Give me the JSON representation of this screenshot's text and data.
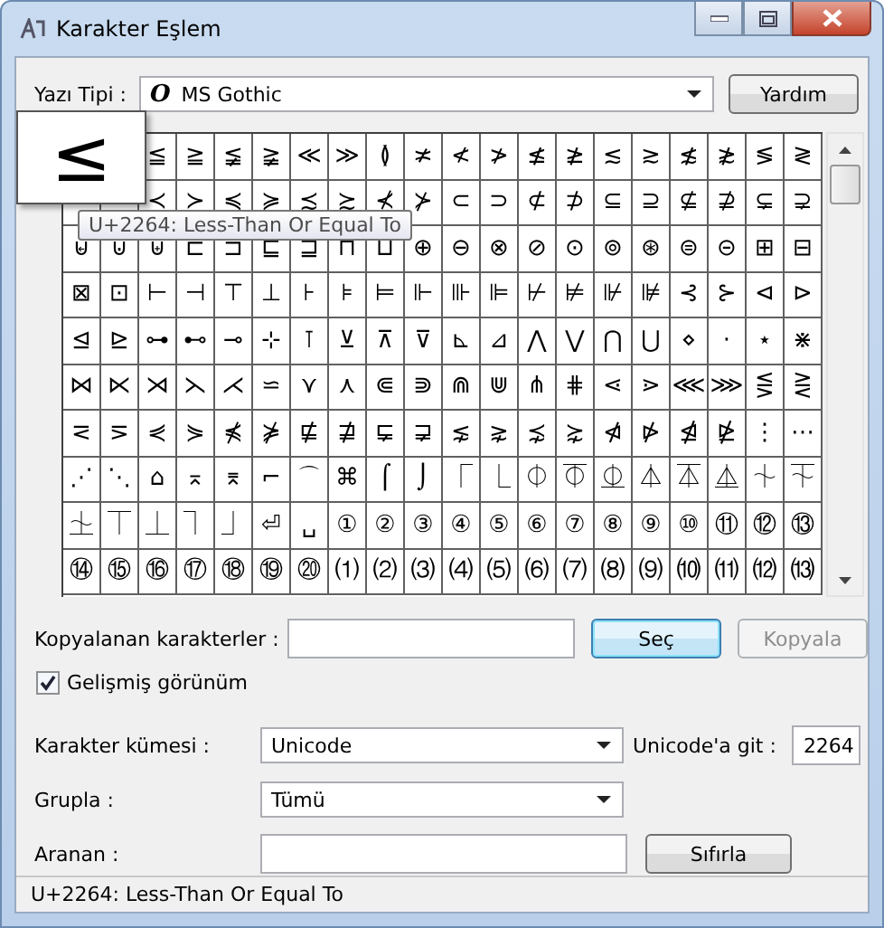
{
  "window": {
    "title": "Karakter Eşlem"
  },
  "font": {
    "label": "Yazı Tipi :",
    "icon": "O",
    "value": "MS Gothic"
  },
  "help_button": "Yardım",
  "grid": {
    "rows": [
      [
        "≦",
        "≧",
        "≨",
        "≩",
        "≪",
        "≫",
        "≬",
        "≭",
        "≮",
        "≯",
        "≰",
        "≱",
        "≲",
        "≳",
        "≴",
        "≵",
        "≶",
        "≷"
      ],
      [
        "≺",
        "≻",
        "≼",
        "≽",
        "≾",
        "≿",
        "⊀",
        "⊁",
        "⊂",
        "⊃",
        "⊄",
        "⊅",
        "⊆",
        "⊇",
        "⊈",
        "⊉",
        "⊊",
        "⊋"
      ],
      [
        "⊌",
        "⊍",
        "⊎",
        "⊏",
        "⊐",
        "⊑",
        "⊒",
        "⊓",
        "⊔",
        "⊕",
        "⊖",
        "⊗",
        "⊘",
        "⊙",
        "⊚",
        "⊛",
        "⊜",
        "⊝",
        "⊞",
        "⊟"
      ],
      [
        "⊠",
        "⊡",
        "⊢",
        "⊣",
        "⊤",
        "⊥",
        "⊦",
        "⊧",
        "⊨",
        "⊩",
        "⊪",
        "⊫",
        "⊬",
        "⊭",
        "⊮",
        "⊯",
        "⊰",
        "⊱",
        "⊲",
        "⊳"
      ],
      [
        "⊴",
        "⊵",
        "⊶",
        "⊷",
        "⊸",
        "⊹",
        "⊺",
        "⊻",
        "⊼",
        "⊽",
        "⊾",
        "⊿",
        "⋀",
        "⋁",
        "⋂",
        "⋃",
        "⋄",
        "⋅",
        "⋆",
        "⋇"
      ],
      [
        "⋈",
        "⋉",
        "⋊",
        "⋋",
        "⋌",
        "⋍",
        "⋎",
        "⋏",
        "⋐",
        "⋑",
        "⋒",
        "⋓",
        "⋔",
        "⋕",
        "⋖",
        "⋗",
        "⋘",
        "⋙",
        "⋚",
        "⋛"
      ],
      [
        "⋜",
        "⋝",
        "⋞",
        "⋟",
        "⋠",
        "⋡",
        "⋢",
        "⋣",
        "⋤",
        "⋥",
        "⋦",
        "⋧",
        "⋨",
        "⋩",
        "⋪",
        "⋫",
        "⋬",
        "⋭",
        "⋮",
        "⋯"
      ],
      [
        "⋰",
        "⋱",
        "⌂",
        "⌅",
        "⌆",
        "⌐",
        "⌒",
        "⌘",
        "⌠",
        "⌡",
        "⎾",
        "⎿",
        "⏀",
        "⏁",
        "⏂",
        "⏃",
        "⏄",
        "⏅",
        "⏆",
        "⏇"
      ],
      [
        "⏈",
        "⏉",
        "⏊",
        "⏋",
        "⏌",
        "⏎",
        "␣",
        "①",
        "②",
        "③",
        "④",
        "⑤",
        "⑥",
        "⑦",
        "⑧",
        "⑨",
        "⑩",
        "⑪",
        "⑫",
        "⑬"
      ],
      [
        "⑭",
        "⑮",
        "⑯",
        "⑰",
        "⑱",
        "⑲",
        "⑳",
        "⑴",
        "⑵",
        "⑶",
        "⑷",
        "⑸",
        "⑹",
        "⑺",
        "⑻",
        "⑼",
        "⑽",
        "⑾",
        "⑿",
        "⒀"
      ]
    ]
  },
  "magnifier": {
    "char": "≤"
  },
  "tooltip": "U+2264: Less-Than Or Equal To",
  "copy": {
    "label": "Kopyalanan karakterler :"
  },
  "buttons": [
    {
      "label": "Seç",
      "default": true,
      "disabled": false
    },
    {
      "label": "Kopyala",
      "default": false,
      "disabled": true
    }
  ],
  "advanced_view": {
    "label": "Gelişmiş görünüm",
    "checked": true
  },
  "charset": {
    "label": "Karakter kümesi :",
    "value": "Unicode"
  },
  "goto": {
    "label": "Unicode'a git :",
    "value": "2264"
  },
  "group": {
    "label": "Grupla :",
    "value": "Tümü"
  },
  "search": {
    "label": "Aranan :"
  },
  "reset_button": "Sıfırla",
  "status_bar": "U+2264: Less-Than Or Equal To"
}
